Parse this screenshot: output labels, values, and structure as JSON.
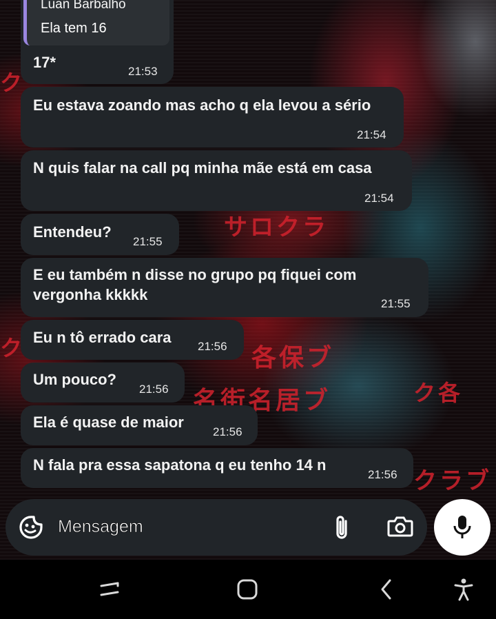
{
  "reply_quote": {
    "author": "Luan Barbalho",
    "text": "Ela tem 16"
  },
  "messages": [
    {
      "text": "17*",
      "time": "21:53"
    },
    {
      "text": "Eu estava zoando mas acho q ela levou a sério",
      "time": "21:54"
    },
    {
      "text": "N quis falar na call pq minha mãe está em casa",
      "time": "21:54"
    },
    {
      "text": "Entendeu?",
      "time": "21:55"
    },
    {
      "text_line1": "E eu também n disse no grupo pq fiquei com",
      "text_line2": "vergonha kkkkk",
      "time": "21:55"
    },
    {
      "text": "Eu n tô errado cara",
      "time": "21:56"
    },
    {
      "text": "Um pouco?",
      "time": "21:56"
    },
    {
      "text": "Ela é quase de maior",
      "time": "21:56"
    },
    {
      "text": "N fala pra essa sapatona q eu tenho 14 n",
      "time": "21:56"
    }
  ],
  "composer": {
    "placeholder": "Mensagem",
    "emoji_icon": "sticker-emoji-icon",
    "attach_icon": "paperclip-icon",
    "camera_icon": "camera-icon",
    "mic_icon": "microphone-icon"
  },
  "navigation": {
    "recents_icon": "recent-apps-icon",
    "home_icon": "home-icon",
    "back_icon": "back-icon",
    "accessibility_icon": "accessibility-icon"
  },
  "colors": {
    "bubble": "#212529",
    "quote_bar": "#9a86e0",
    "wallpaper_accent": "#d2222d"
  }
}
